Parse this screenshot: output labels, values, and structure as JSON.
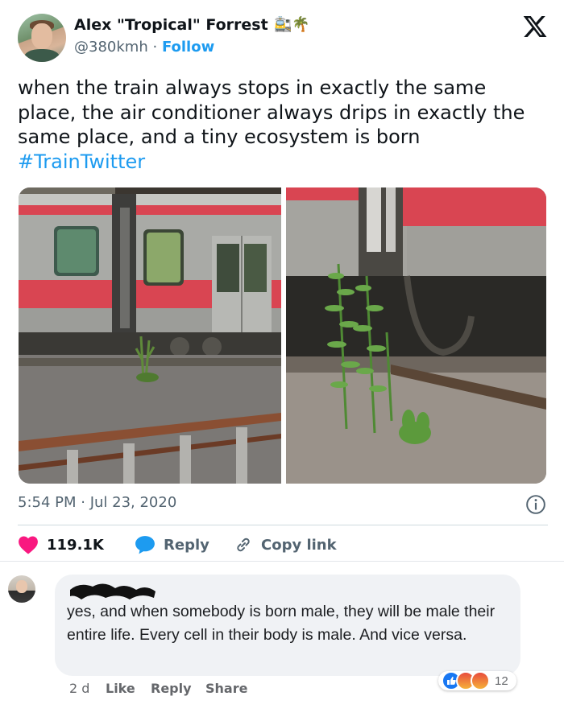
{
  "tweet": {
    "author_name": "Alex \"Tropical\" Forrest",
    "author_emoji": "🚉🌴",
    "handle": "@380kmh",
    "separator": "·",
    "follow_label": "Follow",
    "text": "when the train always stops in exactly the same place, the air conditioner always drips in exactly the same place, and a tiny ecosystem is born",
    "hashtag": "#TrainTwitter",
    "timestamp": "5:54 PM · Jul 23, 2020",
    "likes": "119.1K",
    "reply_label": "Reply",
    "copy_link_label": "Copy link",
    "icons": [
      "x-logo-icon",
      "info-icon",
      "heart-icon",
      "reply-bubble-icon",
      "link-icon"
    ],
    "colors": {
      "like": "#f91880",
      "link": "#1d9bf0",
      "reply": "#1d9bf0",
      "secondary": "#536471"
    }
  },
  "comment": {
    "text": "yes, and when somebody is born male, they will be male their entire life. Every cell in their body is male. And vice versa.",
    "time": "2 d",
    "like_label": "Like",
    "reply_label": "Reply",
    "share_label": "Share",
    "reaction_count": "12",
    "reactions": [
      "like-reaction-icon",
      "angry-reaction-icon",
      "angry-reaction-icon"
    ],
    "colors": {
      "bubble": "#f0f2f5",
      "like_reaction": "#1877f2"
    }
  }
}
